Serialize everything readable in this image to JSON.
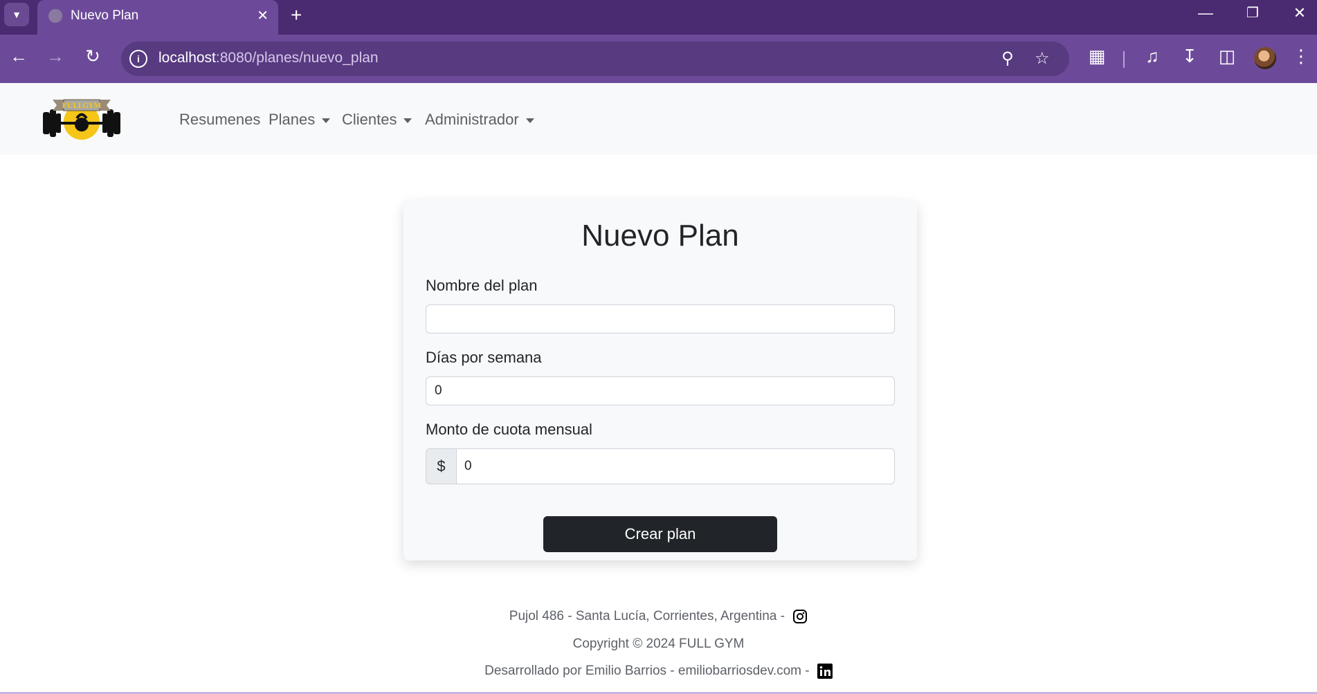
{
  "browser": {
    "tab_title": "Nuevo Plan",
    "url_host": "localhost",
    "url_path": ":8080/planes/nuevo_plan",
    "colors": {
      "frame": "#4a2a70",
      "toolbar": "#6c4a99",
      "omnibox": "#573a80"
    }
  },
  "navbar": {
    "logo_text": "FULLGYM",
    "items": [
      {
        "label": "Resumenes",
        "dropdown": false
      },
      {
        "label": "Planes",
        "dropdown": true
      },
      {
        "label": "Clientes",
        "dropdown": true
      },
      {
        "label": "Administrador",
        "dropdown": true
      }
    ]
  },
  "form": {
    "title": "Nuevo Plan",
    "fields": [
      {
        "label": "Nombre del plan",
        "value": ""
      },
      {
        "label": "Días por semana",
        "value": "0"
      },
      {
        "label": "Monto de cuota mensual",
        "prefix": "$",
        "value": "0"
      }
    ],
    "submit_label": "Crear plan"
  },
  "footer": {
    "address": "Pujol 486 - Santa Lucía, Corrientes, Argentina -",
    "copyright": "Copyright © 2024 FULL GYM",
    "developer": "Desarrollado por Emilio Barrios - emiliobarriosdev.com -",
    "icons": [
      "instagram-icon",
      "linkedin-icon"
    ]
  }
}
